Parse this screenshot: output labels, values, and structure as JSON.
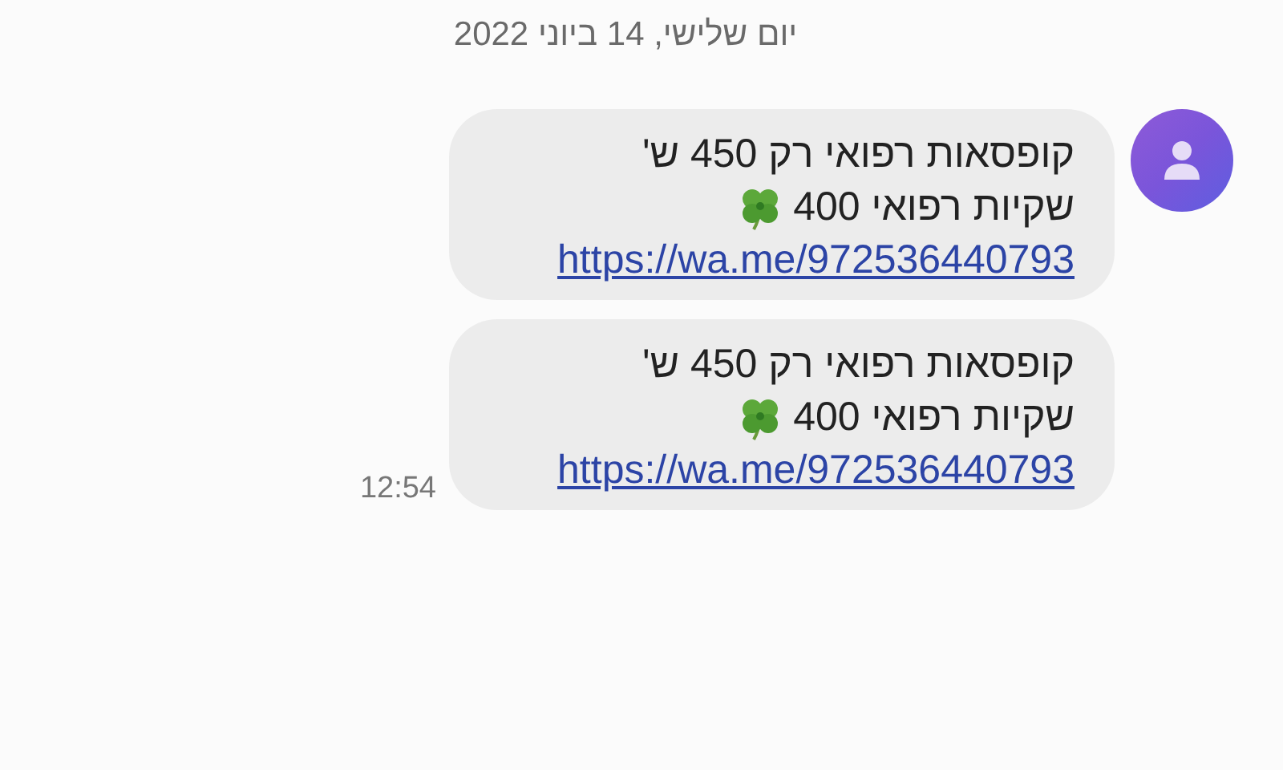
{
  "date_header": "יום שלישי, 14 ביוני 2022",
  "messages": [
    {
      "avatar": true,
      "lines": [
        "קופסאות רפואי רק 450 ש'",
        "שקיות רפואי 400"
      ],
      "link": "https://wa.me/972536440793"
    },
    {
      "avatar": false,
      "lines": [
        "קופסאות רפואי רק 450 ש'",
        "שקיות רפואי 400"
      ],
      "link": "https://wa.me/972536440793",
      "time": "12:54"
    }
  ]
}
